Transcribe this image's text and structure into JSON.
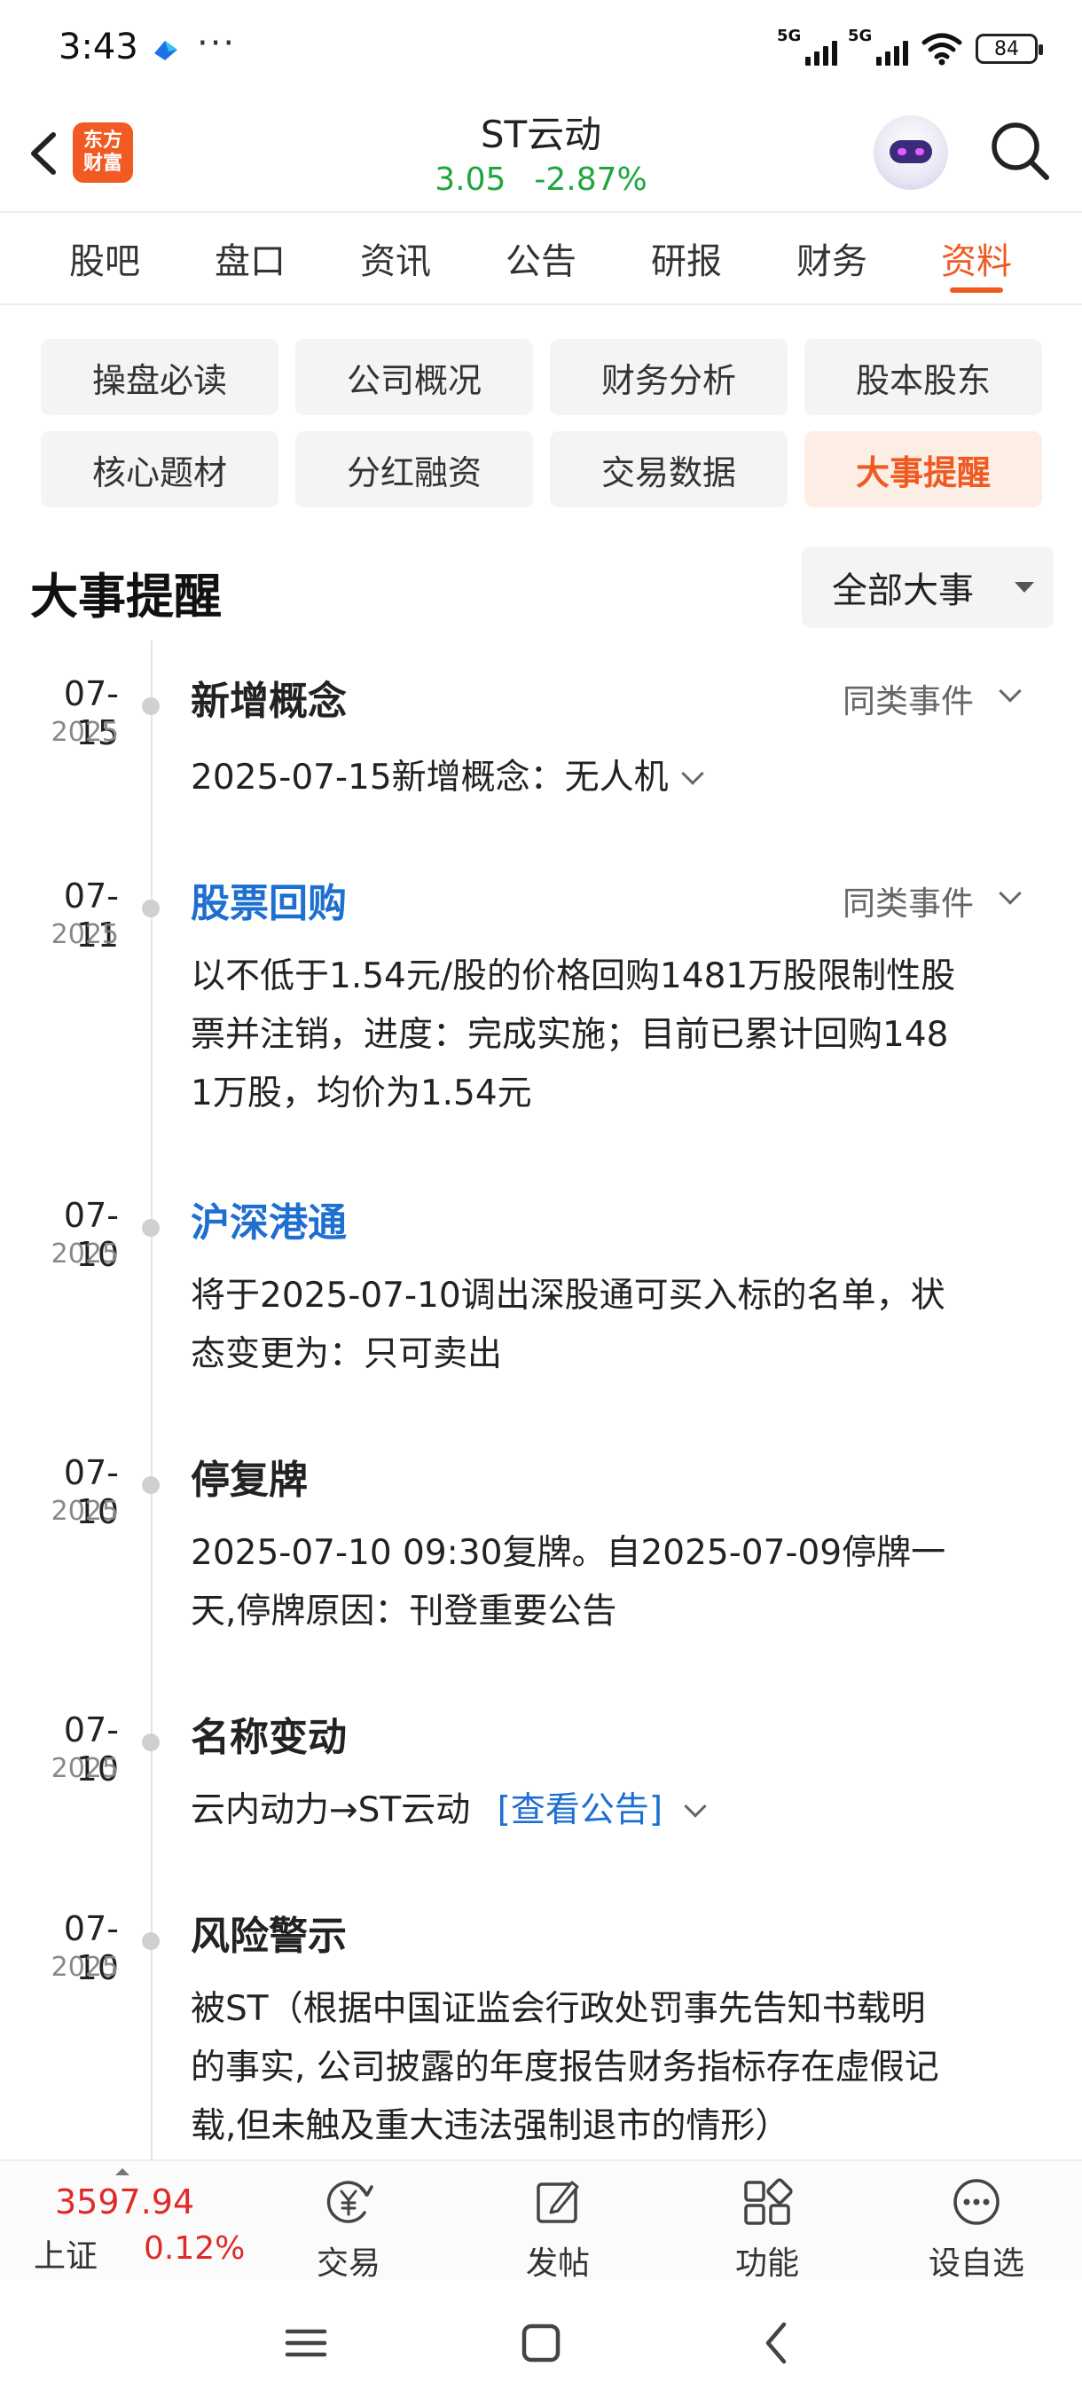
{
  "status_bar": {
    "time": "3:43",
    "more": "···",
    "signal1": "5G",
    "signal2": "5G",
    "battery": "84"
  },
  "header": {
    "logo_line1": "东方",
    "logo_line2": "财富",
    "stock_name": "ST云动",
    "price": "3.05",
    "change_pct": "-2.87%"
  },
  "tabs": [
    {
      "label": "股吧"
    },
    {
      "label": "盘口"
    },
    {
      "label": "资讯"
    },
    {
      "label": "公告"
    },
    {
      "label": "研报"
    },
    {
      "label": "财务"
    },
    {
      "label": "资料"
    }
  ],
  "active_tab": "资料",
  "chips": [
    {
      "label": "操盘必读"
    },
    {
      "label": "公司概况"
    },
    {
      "label": "财务分析"
    },
    {
      "label": "股本股东"
    },
    {
      "label": "核心题材"
    },
    {
      "label": "分红融资"
    },
    {
      "label": "交易数据"
    },
    {
      "label": "大事提醒"
    }
  ],
  "active_chip": "大事提醒",
  "section": {
    "title": "大事提醒",
    "filter": "全部大事"
  },
  "similar_label": "同类事件",
  "events": [
    {
      "date": "07-15",
      "year": "2025",
      "title": "新增概念",
      "body": "2025-07-15新增概念：无人机"
    },
    {
      "date": "07-11",
      "year": "2025",
      "title": "股票回购",
      "body_lines": [
        "以不低于1.54元/股的价格回购1481万股限制性股",
        "票并注销，进度：完成实施；目前已累计回购148",
        "1万股，均价为1.54元"
      ]
    },
    {
      "date": "07-10",
      "year": "2025",
      "title": "沪深港通",
      "body_lines": [
        "将于2025-07-10调出深股通可买入标的名单，状",
        "态变更为：只可卖出"
      ]
    },
    {
      "date": "07-10",
      "year": "2025",
      "title": "停复牌",
      "body_lines": [
        "2025-07-10 09:30复牌。自2025-07-09停牌一",
        "天,停牌原因：刊登重要公告"
      ]
    },
    {
      "date": "07-10",
      "year": "2025",
      "title": "名称变动",
      "body": "云内动力→ST云动",
      "link": "[查看公告]"
    },
    {
      "date": "07-10",
      "year": "2025",
      "title": "风险警示",
      "body_lines": [
        "被ST（根据中国证监会行政处罚事先告知书载明",
        "的事实, 公司披露的年度报告财务指标存在虚假记",
        "载,但未触及重大违法强制退市的情形）"
      ]
    }
  ],
  "bottom_nav": {
    "index_value": "3597.94",
    "index_name": "上证",
    "index_pct": "0.12%",
    "items": [
      {
        "label": "交易"
      },
      {
        "label": "发帖"
      },
      {
        "label": "功能"
      },
      {
        "label": "设自选"
      }
    ]
  },
  "colors": {
    "accent": "#ef5a22",
    "up_red": "#e02a2a",
    "down_green": "#1ea53e",
    "link_blue": "#1e6fd0"
  }
}
